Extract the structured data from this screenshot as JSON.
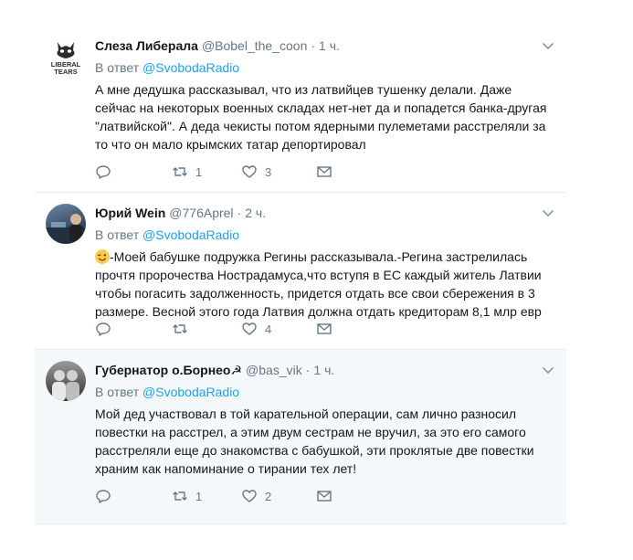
{
  "tweets": [
    {
      "name": "Слеза Либерала",
      "handle": "@Bobel_the_coon",
      "dot": "·",
      "time": "1 ч.",
      "reply_prefix": "В ответ",
      "reply_to": "@SvobodaRadio",
      "text": "А мне дедушка рассказывал, что из латвийцев тушенку делали. Даже сейчас на некоторых военных складах нет-нет да и попадется банка-другая \"латвийской\". А деда чекисты потом ядерными пулеметами расстреляли за то что он мало крымских татар депортировал",
      "avatar_text": [
        "LIBERAL",
        "TEARS"
      ],
      "replies": "",
      "retweets": "1",
      "likes": "3"
    },
    {
      "name": "Юрий Wein",
      "handle": "@776Aprel",
      "dot": "·",
      "time": "2 ч.",
      "reply_prefix": "В ответ",
      "reply_to": "@SvobodaRadio",
      "text": "-Моей бабушке подружка Регины рассказывала.-Регина застрелилась прочтя пророчества Нострадамуса,что вступя в ЕС каждый житель Латвии чтобы погасить задолженность,  придется отдать все свои сбережения в 3 размере. Весной этого года Латвия должна отдать  кредиторам 8,1 млр евр",
      "replies": "",
      "retweets": "",
      "likes": "4"
    },
    {
      "name": "Губернатор о.Борнео☭",
      "handle": "@bas_vik",
      "dot": "·",
      "time": "1 ч.",
      "reply_prefix": "В ответ",
      "reply_to": "@SvobodaRadio",
      "text": "Мой дед участвовал в той карательной операции, сам лично разносил повестки на расстрел, а этим двум сестрам не вручил, за это его самого расстреляли еще до знакомства с бабушкой, эти проклятые две повестки храним как напоминание о тирании тех лет!",
      "replies": "",
      "retweets": "1",
      "likes": "2"
    }
  ],
  "icons": {
    "reply": "reply-icon",
    "retweet": "retweet-icon",
    "like": "heart-icon",
    "dm": "envelope-icon",
    "caret": "chevron-down-icon",
    "emoji": "winking-face-icon"
  },
  "colors": {
    "link": "#1da1f2",
    "muted": "#657786",
    "text": "#14171a",
    "highlight_bg": "#f5f8fa"
  }
}
